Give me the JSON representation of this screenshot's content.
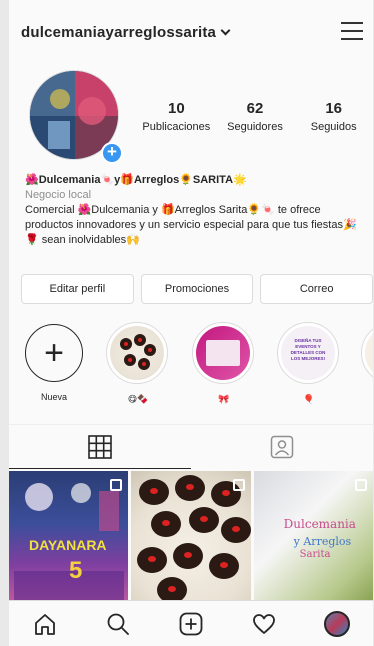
{
  "header": {
    "username": "dulcemaniayarreglossarita"
  },
  "profile": {
    "stats": [
      {
        "value": "10",
        "label": "Publicaciones"
      },
      {
        "value": "62",
        "label": "Seguidores"
      },
      {
        "value": "16",
        "label": "Seguidos"
      }
    ],
    "name": "🌺Dulcemania🍬y🎁Arreglos🌻SARITA🌟",
    "category": "Negocio local",
    "bio_line1": "Comercial 🌺Dulcemania y 🎁Arreglos Sarita🌻🍬 te ofrece",
    "bio_line2": "productos innovadores y un servicio especial para que tus fiestas🎉",
    "bio_line3": "🌹 sean inolvidables🙌"
  },
  "actions": {
    "edit_profile": "Editar perfil",
    "promotions": "Promociones",
    "email": "Correo"
  },
  "highlights": [
    {
      "label": "Nueva"
    },
    {
      "label": "😋🍫"
    },
    {
      "label": "🎀"
    },
    {
      "label": "🎈"
    }
  ],
  "highlight_texts": {
    "h3": "DISEÑA TUS EVENTOS Y DETALLES CON LOS MEJORES!"
  },
  "posts": {
    "post1_text": "DAYANARA",
    "post1_num": "5",
    "post3_line1": "Dulcemania",
    "post3_line2": "y Arreglos",
    "post3_line3": "Sarita"
  },
  "icons": {
    "menu": "hamburger-icon",
    "add_avatar": "plus-icon",
    "grid_tab": "grid-icon",
    "tagged_tab": "tagged-person-icon",
    "home": "home-icon",
    "search": "search-icon",
    "new_post": "add-post-icon",
    "activity": "heart-icon",
    "profile": "profile-avatar-icon"
  },
  "colors": {
    "accent_blue": "#3897f0",
    "text": "#262626",
    "secondary_text": "#8e8e8e",
    "border": "#dbdbdb"
  }
}
